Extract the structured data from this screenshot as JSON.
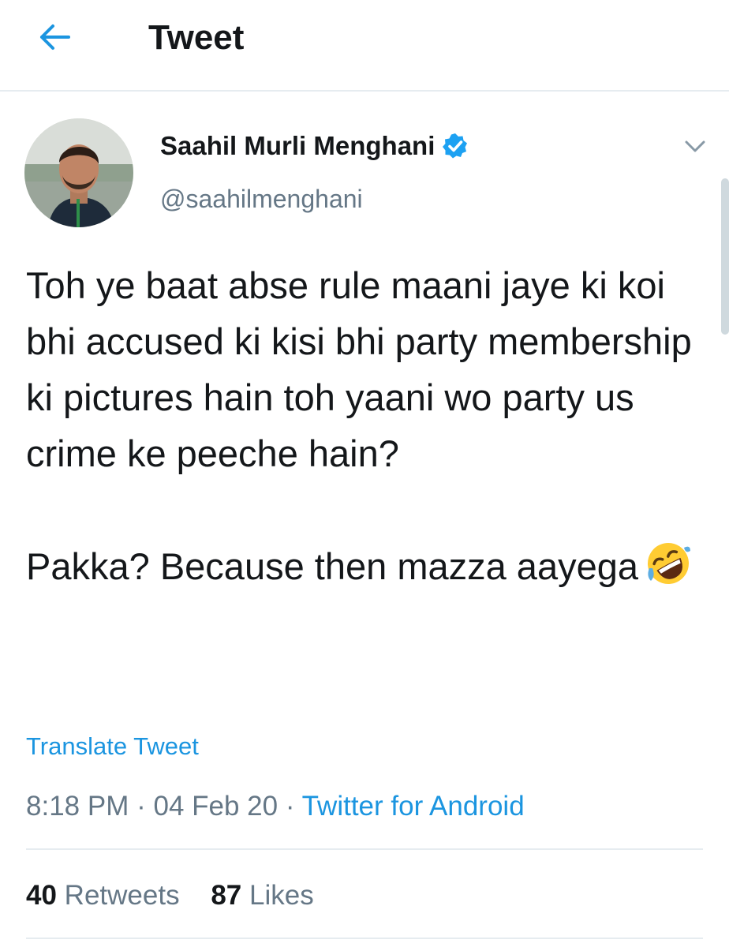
{
  "header": {
    "title": "Tweet",
    "back_icon": "arrow-left-icon"
  },
  "tweet": {
    "author": {
      "display_name": "Saahil Murli Menghani",
      "handle": "@saahilmenghani",
      "verified": true,
      "verified_icon": "verified-badge-icon"
    },
    "menu_icon": "chevron-down-icon",
    "text": {
      "paragraph1": "Toh ye baat abse rule maani jaye ki koi bhi accused ki kisi bhi party membership ki pictures hain toh yaani wo party us crime ke peeche hain?",
      "paragraph2": "Pakka? Because then mazza aayega",
      "emoji": "rolling-on-floor-laughing-emoji"
    },
    "translate_label": "Translate Tweet",
    "time": "8:18 PM",
    "separator": "·",
    "date": "04 Feb 20",
    "source": "Twitter for Android",
    "stats": {
      "retweets_count": "40",
      "retweets_label": "Retweets",
      "likes_count": "87",
      "likes_label": "Likes"
    }
  },
  "colors": {
    "accent": "#1b95e0",
    "secondary_text": "#657786",
    "primary_text": "#14171a",
    "divider": "#e6ecf0"
  }
}
